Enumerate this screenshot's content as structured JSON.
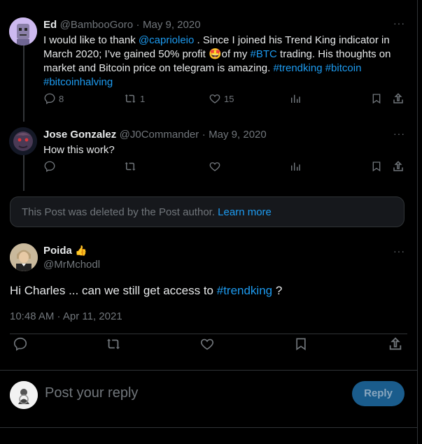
{
  "tweets": [
    {
      "name": "Ed",
      "handle": "@BambooGoro",
      "date": "May 9, 2020",
      "text_parts": [
        {
          "t": "I would like to thank "
        },
        {
          "t": "@caprioleio",
          "link": true
        },
        {
          "t": " . Since I joined his Trend King indicator in March 2020; I’ve gained 50% profit "
        },
        {
          "t": "🤩",
          "emoji": true
        },
        {
          "t": "of my "
        },
        {
          "t": "#BTC",
          "link": true
        },
        {
          "t": " trading. His thoughts on market and Bitcoin price on telegram is amazing. "
        },
        {
          "t": "#trendking",
          "link": true
        },
        {
          "t": " "
        },
        {
          "t": "#bitcoin",
          "link": true
        },
        {
          "t": " "
        },
        {
          "t": "#bitcoinhalving",
          "link": true
        }
      ],
      "replies": "8",
      "reposts": "1",
      "likes": "15"
    },
    {
      "name": "Jose Gonzalez",
      "handle": "@J0Commander",
      "date": "May 9, 2020",
      "text": "How this work?",
      "replies": "",
      "reposts": "",
      "likes": ""
    }
  ],
  "deleted": {
    "text": "This Post was deleted by the Post author.",
    "learn_more": "Learn more"
  },
  "main": {
    "name": "Poida",
    "name_emoji": "👍",
    "handle": "@MrMchodl",
    "text_prefix": "Hi Charles ... can we still get access to ",
    "hashtag": "#trendking",
    "text_suffix": " ?",
    "timestamp": "10:48 AM · Apr 11, 2021"
  },
  "reply_box": {
    "placeholder": "Post your reply",
    "button": "Reply"
  },
  "more_glyph": "···",
  "colors": {
    "accent": "#1d9bf0",
    "muted": "#71767b",
    "background": "#000000",
    "reply_button": "#1a5c8c"
  }
}
